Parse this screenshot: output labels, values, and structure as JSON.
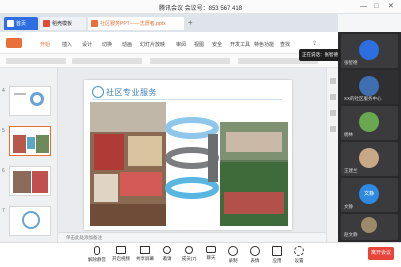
{
  "window": {
    "title": "腾讯会议 会议号：853 567 418",
    "minimize": "—",
    "maximize": "□",
    "close": "✕"
  },
  "tabs": [
    {
      "label": "首页",
      "color": "#2d6fe0"
    },
    {
      "label": "稻壳模板",
      "color": "#e04a39"
    },
    {
      "label": "社区服务PPT——志愿者.pptx",
      "color": "#e8703a"
    }
  ],
  "menu": [
    "开始",
    "插入",
    "设计",
    "切换",
    "动画",
    "幻灯片放映",
    "审阅",
    "视图",
    "安全",
    "开发工具",
    "特色功能",
    "查找"
  ],
  "slide_panel": {
    "numbers": [
      "4",
      "5",
      "6",
      "7"
    ]
  },
  "slide": {
    "title": "社区专业服务"
  },
  "notes_placeholder": "单击此处添加备注",
  "participants": {
    "tooltip": "正在说话：张智德",
    "names": [
      "张智德",
      "XX的社区服务中心",
      "杨林",
      "王建兰",
      "文静",
      "赵文静"
    ],
    "initials_badge": "文静"
  },
  "toolbar": {
    "items": [
      "解除静音",
      "开启视频",
      "共享屏幕",
      "邀请",
      "成员(7)",
      "聊天",
      "录制",
      "表情",
      "应用",
      "设置"
    ],
    "end_label": "离开会议"
  }
}
